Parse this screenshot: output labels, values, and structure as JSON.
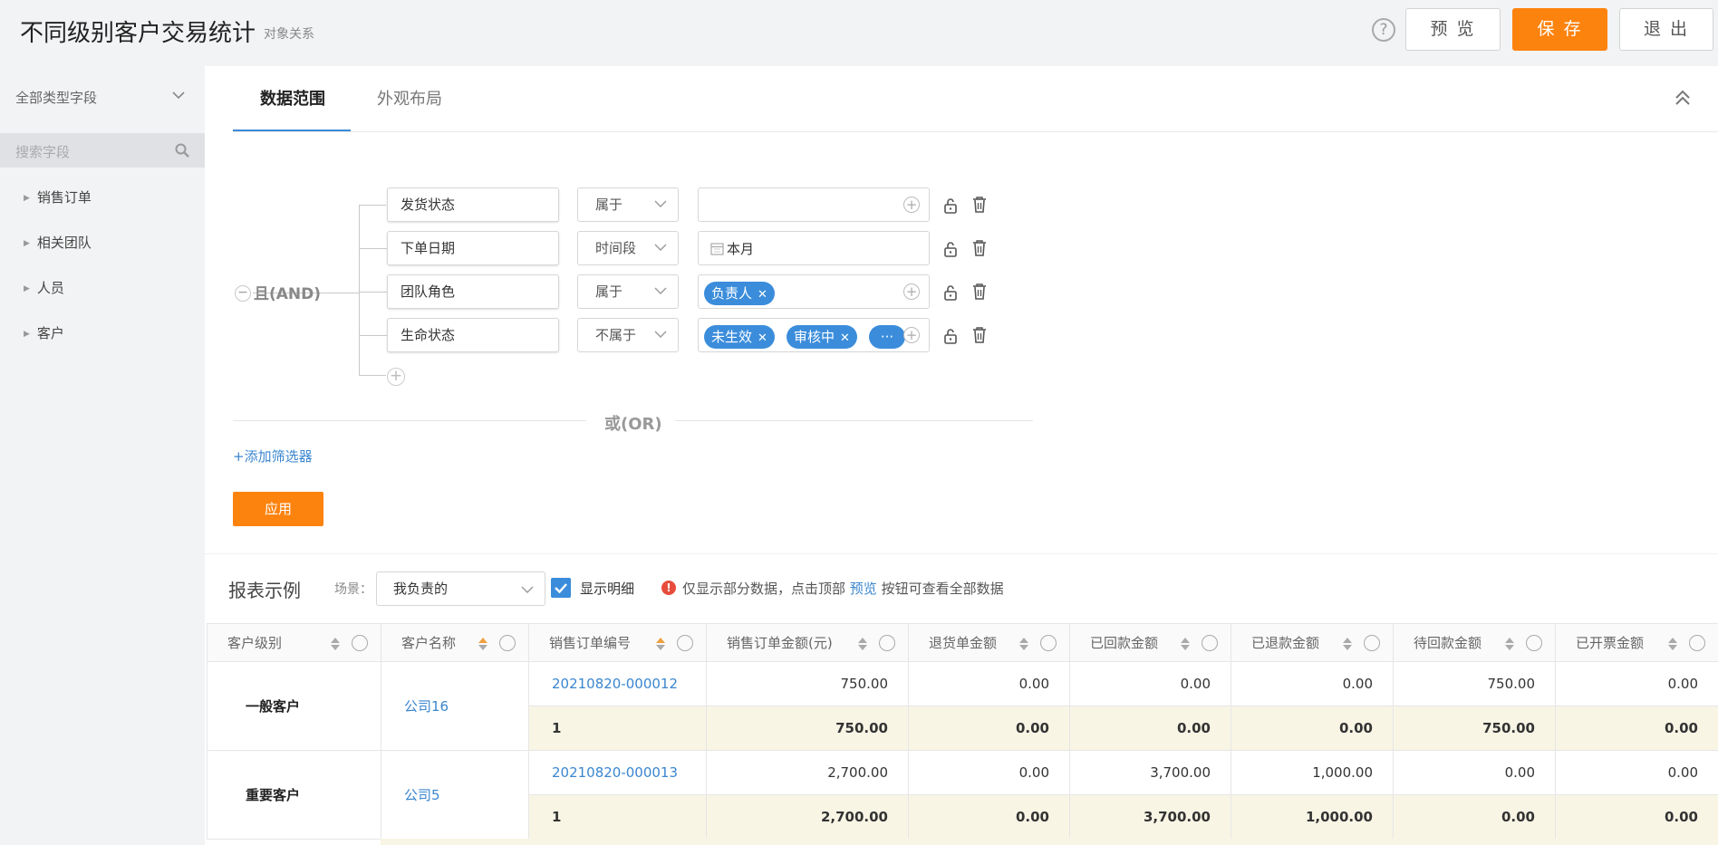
{
  "header": {
    "title": "不同级别客户交易统计",
    "subtitle": "对象关系",
    "help": "?",
    "preview_label": "预 览",
    "save_label": "保 存",
    "exit_label": "退 出"
  },
  "sidebar": {
    "field_type": "全部类型字段",
    "search_placeholder": "搜索字段",
    "items": [
      {
        "label": "销售订单"
      },
      {
        "label": "相关团队"
      },
      {
        "label": "人员"
      },
      {
        "label": "客户"
      }
    ]
  },
  "tabs": [
    {
      "label": "数据范围"
    },
    {
      "label": "外观布局"
    }
  ],
  "filter_group": {
    "logic_label": "且(AND)",
    "minus": "−",
    "rows": [
      {
        "field": "发货状态",
        "operator": "属于",
        "value": ""
      },
      {
        "field": "下单日期",
        "operator": "时间段",
        "value": "本月"
      },
      {
        "field": "团队角色",
        "operator": "属于",
        "chips": [
          "负责人"
        ]
      },
      {
        "field": "生命状态",
        "operator": "不属于",
        "chips": [
          "未生效",
          "审核中",
          "···"
        ]
      }
    ],
    "add": "+",
    "or_label": "或(OR)",
    "add_filter": "+添加筛选器",
    "apply": "应用"
  },
  "report": {
    "title": "报表示例",
    "scene_label": "场景：",
    "scene_value": "我负责的",
    "show_detail_label": "显示明细",
    "show_detail_checked": true,
    "warning_prefix": "仅显示部分数据，点击顶部",
    "warning_link": "预览",
    "warning_suffix": "按钮可查看全部数据"
  },
  "table": {
    "columns": [
      "客户级别",
      "客户名称",
      "销售订单编号",
      "销售订单金额(元)",
      "退货单金额",
      "已回款金额",
      "已退款金额",
      "待回款金额",
      "已开票金额"
    ],
    "groups": [
      {
        "level": "一般客户",
        "name": "公司16",
        "detail": [
          "20210820-000012",
          "750.00",
          "0.00",
          "0.00",
          "0.00",
          "750.00",
          "0.00"
        ],
        "subtotal": [
          "1",
          "750.00",
          "0.00",
          "0.00",
          "0.00",
          "750.00",
          "0.00"
        ]
      },
      {
        "level": "重要客户",
        "name": "公司5",
        "detail": [
          "20210820-000013",
          "2,700.00",
          "0.00",
          "3,700.00",
          "1,000.00",
          "0.00",
          "0.00"
        ],
        "subtotal": [
          "1",
          "2,700.00",
          "0.00",
          "3,700.00",
          "1,000.00",
          "0.00",
          "0.00"
        ]
      }
    ]
  },
  "colors": {
    "accent": "#fd830f",
    "link": "#3a86cf",
    "chip": "#3b8ddb",
    "subtotal_bg": "#f8f5e5"
  }
}
